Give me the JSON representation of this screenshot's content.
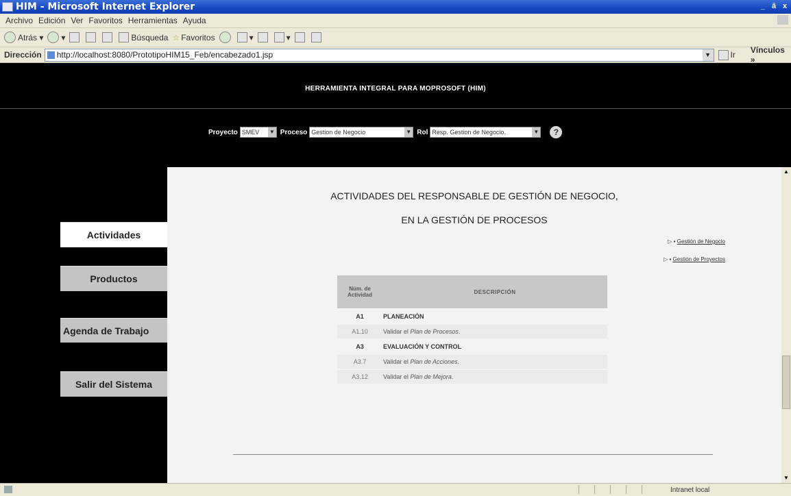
{
  "window": {
    "title": "HIM - Microsoft Internet Explorer",
    "buttons": [
      "_",
      "ā",
      "x"
    ]
  },
  "menu": [
    "Archivo",
    "Edición",
    "Ver",
    "Favoritos",
    "Herramientas",
    "Ayuda"
  ],
  "toolbar": {
    "back": "Atrás",
    "search": "Búsqueda",
    "favorites": "Favoritos"
  },
  "address": {
    "label": "Dirección",
    "url": "http://localhost:8080/PrototipoHIM15_Feb/encabezado1.jsp",
    "go": "Ir",
    "links": "Vínculos »"
  },
  "header": {
    "title": "HERRAMIENTA INTEGRAL PARA MOPROSOFT (HIM)"
  },
  "selectors": {
    "proyecto_label": "Proyecto",
    "proyecto_value": "SMEV",
    "proceso_label": "Proceso",
    "proceso_value": "Gestion de Negocio",
    "rol_label": "Rol",
    "rol_value": "Resp. Gestion de Negocio."
  },
  "nav": [
    "Actividades",
    "Productos",
    "Agenda de Trabajo",
    "Salir del Sistema"
  ],
  "content": {
    "title1": "ACTIVIDADES DEL RESPONSABLE DE GESTIÓN DE NEGOCIO,",
    "title2": "EN LA GESTIÓN DE PROCESOS",
    "link1": "Gestión de Negocio",
    "link2": "Gestión de Proyectos",
    "table": {
      "col_num": "Núm. de Actividad",
      "col_desc": "DESCRIPCIÓN",
      "rows": [
        {
          "num": "A1",
          "desc": "PLANEACIÓN",
          "bold": true
        },
        {
          "num": "A1.10",
          "desc_prefix": "Validar el ",
          "desc_em": "Plan de Procesos",
          "desc_suffix": "."
        },
        {
          "num": "A3",
          "desc": "EVALUACIÓN Y CONTROL",
          "bold": true
        },
        {
          "num": "A3.7",
          "desc_prefix": "Validar el ",
          "desc_em": "Plan de Acciones",
          "desc_suffix": "."
        },
        {
          "num": "A3.12",
          "desc_prefix": "Validar el ",
          "desc_em": "Plan de Mejora",
          "desc_suffix": "."
        }
      ]
    }
  },
  "status": {
    "zone": "Intranet local"
  }
}
